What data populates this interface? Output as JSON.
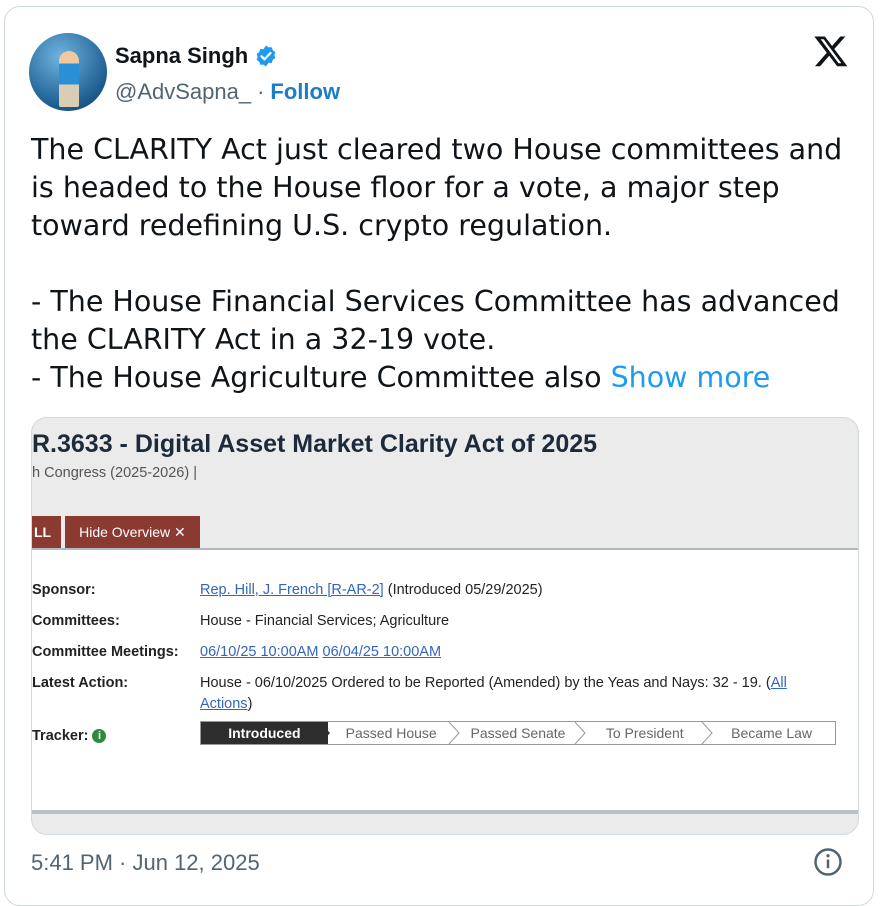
{
  "author": {
    "name": "Sapna Singh",
    "handle": "@AdvSapna_",
    "separator": "·",
    "follow_label": "Follow",
    "verified_icon": "verified-badge-icon"
  },
  "tweet": {
    "text": "The CLARITY Act just cleared two House committees and is headed to the House floor for a vote, a major step toward redefining U.S. crypto regulation.\n\n- The House Financial Services Committee has advanced the CLARITY Act in a 32-19 vote.\n- The House Agriculture Committee also ",
    "show_more": "Show more",
    "timestamp": "5:41 PM · Jun 12, 2025"
  },
  "media": {
    "bill_title": "R.3633 - Digital Asset Market Clarity Act of 2025",
    "congress": "h Congress (2025-2026) |",
    "tab_all": "LL",
    "tab_hide": "Hide Overview",
    "tab_hide_icon": "✕",
    "sponsor_label": "Sponsor:",
    "sponsor_link": "Rep. Hill, J. French [R-AR-2]",
    "sponsor_note": " (Introduced 05/29/2025)",
    "committees_label": "Committees:",
    "committees_value": "House - Financial Services; Agriculture",
    "meetings_label": "Committee Meetings:",
    "meeting_1": "06/10/25 10:00AM",
    "meeting_2": "06/04/25 10:00AM",
    "latest_label": "Latest Action:",
    "latest_value": "House - 06/10/2025 Ordered to be Reported (Amended) by the Yeas and Nays: 32 - 19.  (",
    "latest_link_1": "All",
    "latest_link_2": "Actions",
    "latest_close": ")",
    "tracker_label": "Tracker:",
    "tracker_steps": [
      "Introduced",
      "Passed House",
      "Passed Senate",
      "To President",
      "Became Law"
    ]
  },
  "colors": {
    "link_blue": "#1d9bf0",
    "tab_red": "#8a3a30",
    "verified_blue": "#1d9bf0"
  }
}
